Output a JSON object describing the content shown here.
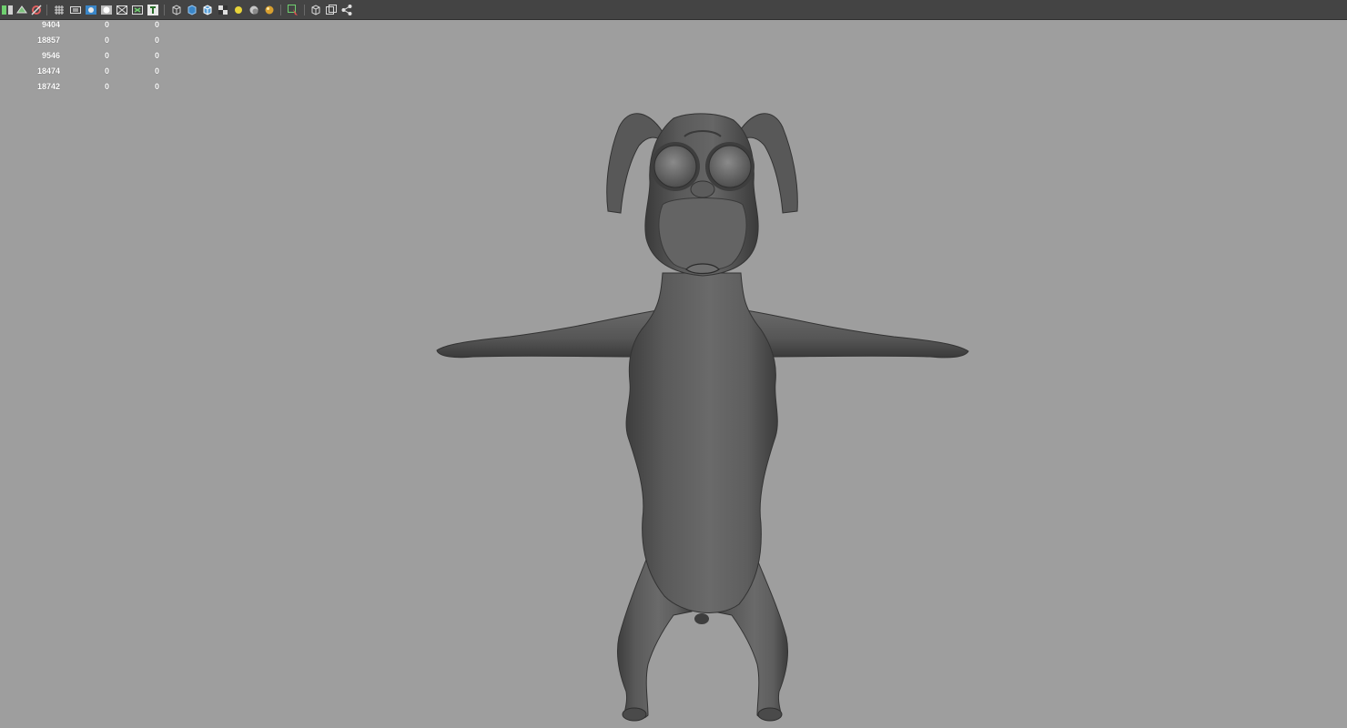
{
  "toolbar": {
    "icons": [
      "panel-layout-icon",
      "camera-attributes-icon",
      "snapshot-icon",
      "grid-icon",
      "film-gate-icon",
      "resolution-gate-icon",
      "field-chart-icon",
      "safe-action-icon",
      "text-tool-icon",
      "wireframe-icon",
      "smooth-shade-icon",
      "wireframe-on-shaded-icon",
      "texture-icon",
      "use-all-lights-icon",
      "shadows-icon",
      "default-material-icon",
      "xray-icon",
      "isolate-select-icon",
      "viewport-menu-icon",
      "share-icon"
    ],
    "accent_color": "#3a86c8"
  },
  "heads_up_display": {
    "rows": [
      {
        "count": "9404",
        "selected": "0",
        "triangles": "0"
      },
      {
        "count": "18857",
        "selected": "0",
        "triangles": "0"
      },
      {
        "count": "9546",
        "selected": "0",
        "triangles": "0"
      },
      {
        "count": "18474",
        "selected": "0",
        "triangles": "0"
      },
      {
        "count": "18742",
        "selected": "0",
        "triangles": "0"
      }
    ]
  },
  "viewport": {
    "background_color": "#9e9e9e",
    "model_color": "#5a5a5a",
    "subject": "dog-character-mesh"
  }
}
